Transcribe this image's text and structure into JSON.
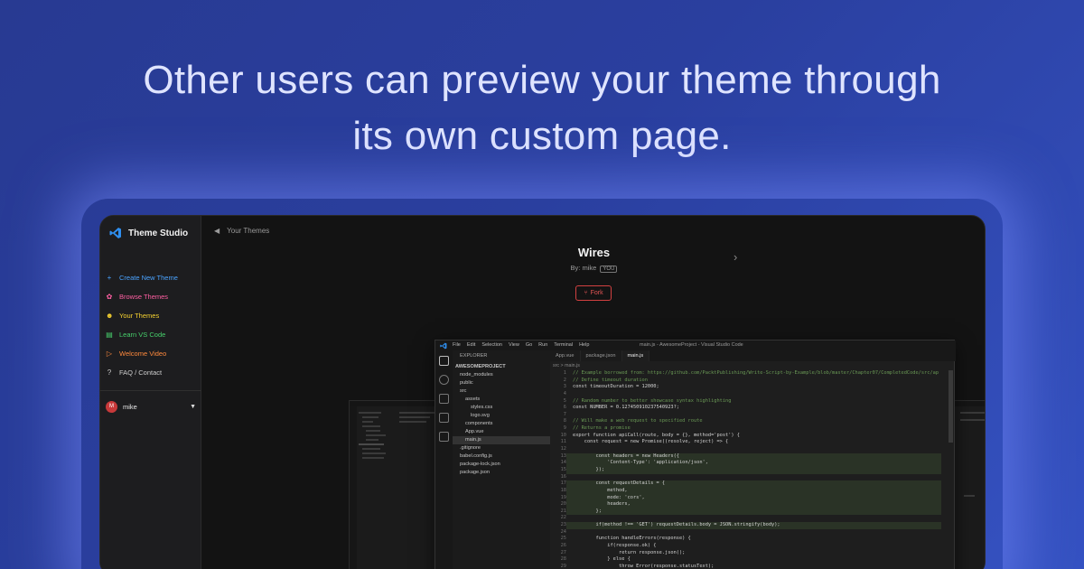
{
  "headline": {
    "line1": "Other users can preview your theme through",
    "line2": "its own custom page."
  },
  "sidebar": {
    "brand": "Theme Studio",
    "items": [
      {
        "label": "Create New Theme",
        "icon": "plus-icon",
        "color": "#4aa3ff"
      },
      {
        "label": "Browse Themes",
        "icon": "palette-icon",
        "color": "#ff5fa2"
      },
      {
        "label": "Your Themes",
        "icon": "smile-icon",
        "color": "#f5d130"
      },
      {
        "label": "Learn VS Code",
        "icon": "book-icon",
        "color": "#47d16c"
      },
      {
        "label": "Welcome Video",
        "icon": "play-icon",
        "color": "#ff8a3d"
      },
      {
        "label": "FAQ / Contact",
        "icon": "help-icon",
        "color": "#cfcfcf"
      }
    ],
    "user": {
      "initial": "M",
      "name": "mike"
    }
  },
  "page": {
    "back_label": "Your Themes",
    "theme_name": "Wires",
    "author_prefix": "By:",
    "author": "mike",
    "author_badge": "YOU",
    "fork_label": "Fork"
  },
  "editor": {
    "menu": [
      "File",
      "Edit",
      "Selection",
      "View",
      "Go",
      "Run",
      "Terminal",
      "Help"
    ],
    "title": "main.js - AwesomeProject - Visual Studio Code",
    "explorer_header": "EXPLORER",
    "tree": [
      {
        "label": "AWESOMEPROJECT",
        "indent": 0
      },
      {
        "label": "node_modules",
        "indent": 1
      },
      {
        "label": "public",
        "indent": 1
      },
      {
        "label": "src",
        "indent": 1
      },
      {
        "label": "assets",
        "indent": 2
      },
      {
        "label": "styles.css",
        "indent": 3
      },
      {
        "label": "logo.svg",
        "indent": 3
      },
      {
        "label": "components",
        "indent": 2
      },
      {
        "label": "App.vue",
        "indent": 2
      },
      {
        "label": "main.js",
        "indent": 2
      },
      {
        "label": ".gitignore",
        "indent": 1
      },
      {
        "label": "babel.config.js",
        "indent": 1
      },
      {
        "label": "package-lock.json",
        "indent": 1
      },
      {
        "label": "package.json",
        "indent": 1
      }
    ],
    "tabs": [
      "App.vue",
      "package.json",
      "main.js"
    ],
    "breadcrumb": "src > main.js",
    "code_lines": [
      "// Example borrowed from: https://github.com/PacktPublishing/Write-Script-by-Example/blob/master/Chapter07/CompletedCode/src/ap",
      "// Define timeout duration",
      "const timeoutDuration = 12000;",
      "",
      "// Random number to better showcase syntax highlighting",
      "const NUMBER = 0.127450910237540923?;",
      "",
      "// Will make a web request to specified route",
      "// Returns a promise",
      "export function apiCall(route, body = {}, method='post') {",
      "    const request = new Promise((resolve, reject) => {",
      "",
      "        const headers = new Headers({",
      "            'Content-Type': 'application/json',",
      "        });",
      "",
      "        const requestDetails = {",
      "            method,",
      "            mode: 'cors',",
      "            headers,",
      "        };",
      "",
      "        if(method !== 'GET') requestDetails.body = JSON.stringify(body);",
      "",
      "        function handleErrors(response) {",
      "            if(response.ok) {",
      "                return response.json();",
      "            } else {",
      "                throw Error(response.statusText);"
    ]
  }
}
